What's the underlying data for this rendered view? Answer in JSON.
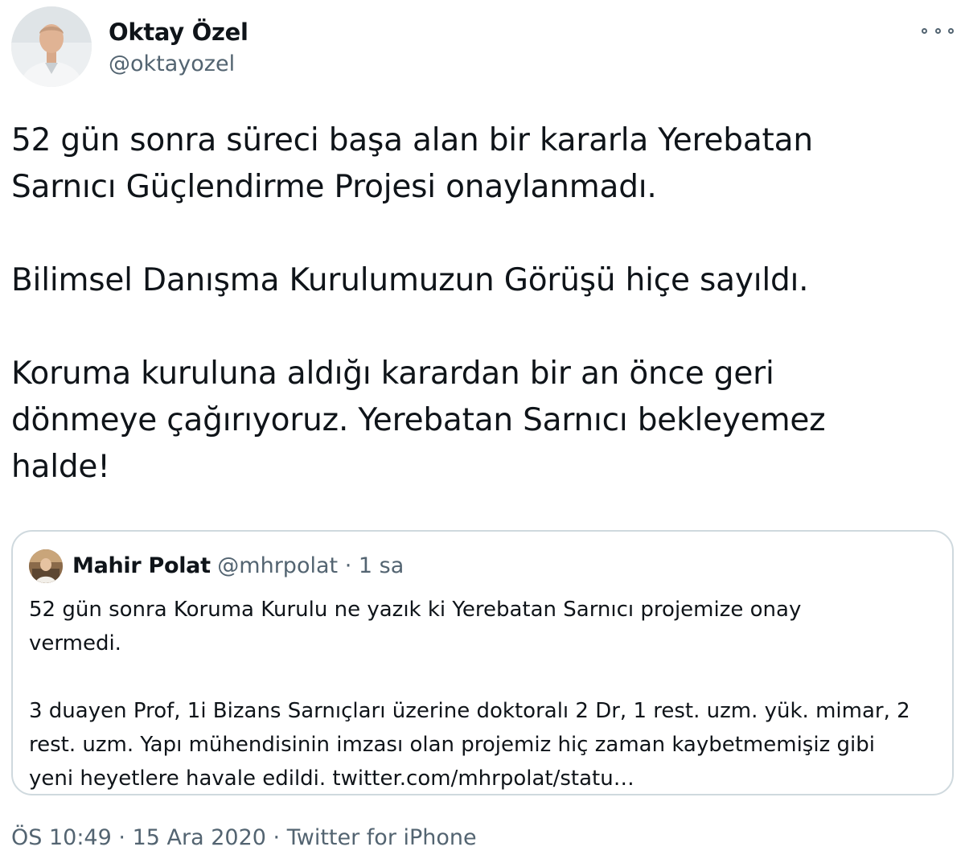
{
  "author": {
    "display_name": "Oktay Özel",
    "handle": "@oktayozel"
  },
  "icons": {
    "more": "more-options-icon"
  },
  "tweet_text": "52 gün sonra süreci başa alan bir kararla Yerebatan\nSarnıcı Güçlendirme Projesi onaylanmadı.\n\nBilimsel Danışma Kurulumuzun Görüşü hiçe sayıldı.\n\nKoruma kuruluna aldığı karardan bir an önce geri\ndönmeye çağırıyoruz. Yerebatan Sarnıcı bekleyemez\nhalde!",
  "quoted_tweet": {
    "display_name": "Mahir Polat",
    "handle": "@mhrpolat",
    "separator": "·",
    "time": "1 sa",
    "text": "52 gün sonra Koruma Kurulu ne yazık ki Yerebatan Sarnıcı projemize onay\nvermedi.\n\n3 duayen Prof, 1i Bizans Sarnıçları üzerine doktoralı 2 Dr, 1 rest. uzm. yük. mimar, 2\nrest. uzm. Yapı mühendisinin imzası olan projemiz hiç zaman kaybetmemişiz gibi\nyeni heyetlere havale edildi. twitter.com/mhrpolat/statu…"
  },
  "footer": {
    "time": "ÖS 10:49",
    "separator": "·",
    "date": "15 Ara 2020",
    "source": "Twitter for iPhone"
  }
}
